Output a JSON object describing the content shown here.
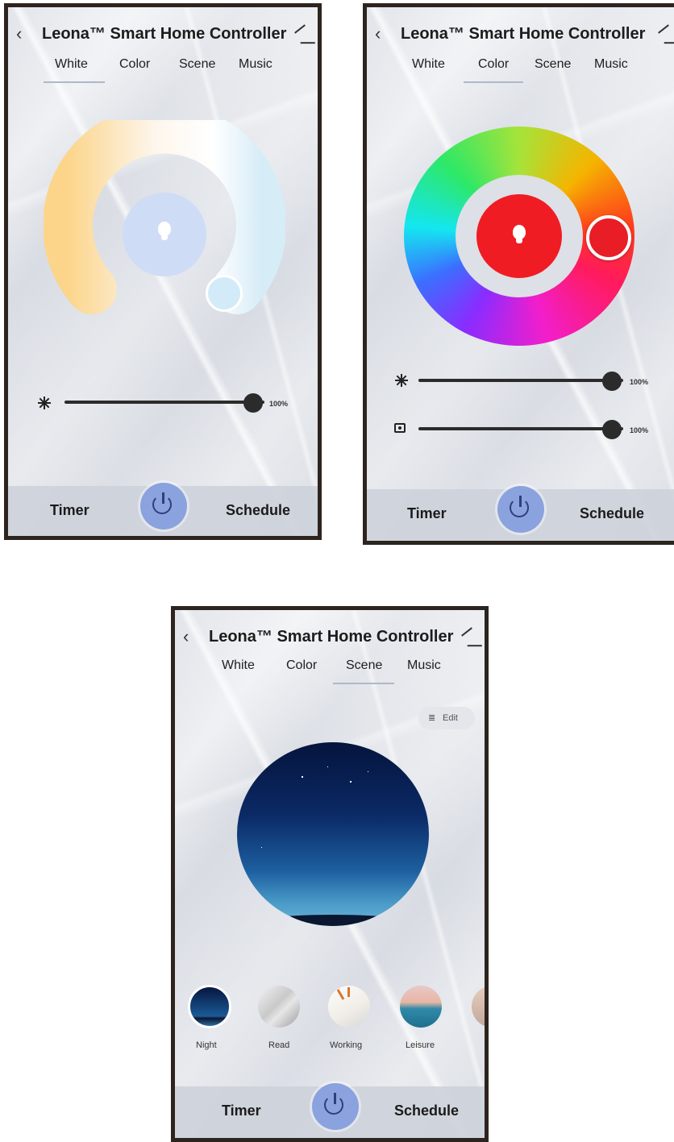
{
  "app": {
    "title": "Leona™ Smart Home Controller",
    "back_icon": "chevron-left-icon",
    "edit_icon": "pencil-icon"
  },
  "tabs": [
    "White",
    "Color",
    "Scene",
    "Music"
  ],
  "bottom_bar": {
    "timer": "Timer",
    "schedule": "Schedule",
    "power_icon": "power-icon"
  },
  "white_screen": {
    "active_tab": "White",
    "brightness": {
      "value": 100,
      "label": "100%"
    }
  },
  "color_screen": {
    "active_tab": "Color",
    "selected_color": "#f01c23",
    "brightness": {
      "value": 100,
      "label": "100%"
    },
    "saturation": {
      "value": 100,
      "label": "100%"
    }
  },
  "scene_screen": {
    "active_tab": "Scene",
    "edit_label": "Edit",
    "scenes": [
      "Night",
      "Read",
      "Working",
      "Leisure"
    ]
  },
  "colors": {
    "power": "#8aa2de",
    "frame": "#2d241f"
  }
}
